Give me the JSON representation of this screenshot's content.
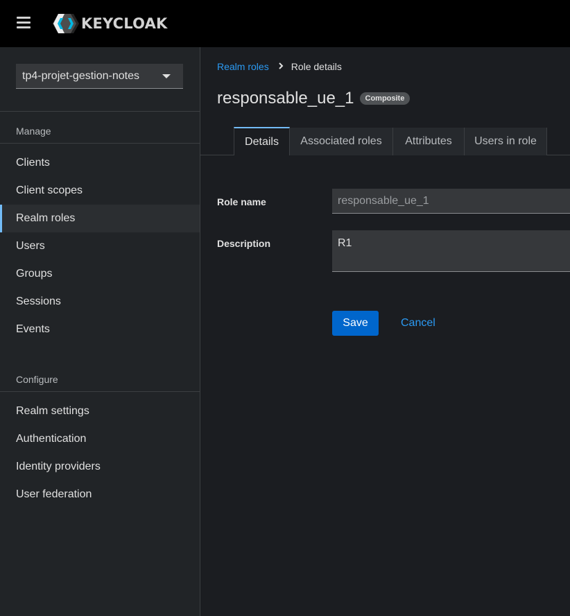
{
  "masthead": {
    "menu_icon": "hamburger-menu-icon",
    "logo_icon": "keycloak-logo-icon",
    "brand": "KEYCLOAK"
  },
  "sidebar": {
    "realm_selector": {
      "value": "tp4-projet-gestion-notes",
      "icon": "caret-down-icon"
    },
    "manage_title": "Manage",
    "manage_items": [
      {
        "label": "Clients"
      },
      {
        "label": "Client scopes"
      },
      {
        "label": "Realm roles",
        "active": true
      },
      {
        "label": "Users"
      },
      {
        "label": "Groups"
      },
      {
        "label": "Sessions"
      },
      {
        "label": "Events"
      }
    ],
    "configure_title": "Configure",
    "configure_items": [
      {
        "label": "Realm settings"
      },
      {
        "label": "Authentication"
      },
      {
        "label": "Identity providers"
      },
      {
        "label": "User federation"
      }
    ]
  },
  "main": {
    "breadcrumb": {
      "parent": "Realm roles",
      "separator_icon": "chevron-right-icon",
      "current": "Role details"
    },
    "title": "responsable_ue_1",
    "badge": "Composite",
    "tabs": [
      {
        "label": "Details",
        "active": true
      },
      {
        "label": "Associated roles"
      },
      {
        "label": "Attributes"
      },
      {
        "label": "Users in role"
      }
    ],
    "form": {
      "role_name_label": "Role name",
      "role_name_value": "responsable_ue_1",
      "description_label": "Description",
      "description_value": "R1"
    },
    "actions": {
      "save": "Save",
      "cancel": "Cancel"
    }
  },
  "colors": {
    "masthead_bg": "#000000",
    "sidebar_bg": "#212427",
    "main_bg": "#1b1d21",
    "link": "#2b9af3",
    "primary_button": "#0066cc",
    "active_indicator": "#73bcf7"
  }
}
